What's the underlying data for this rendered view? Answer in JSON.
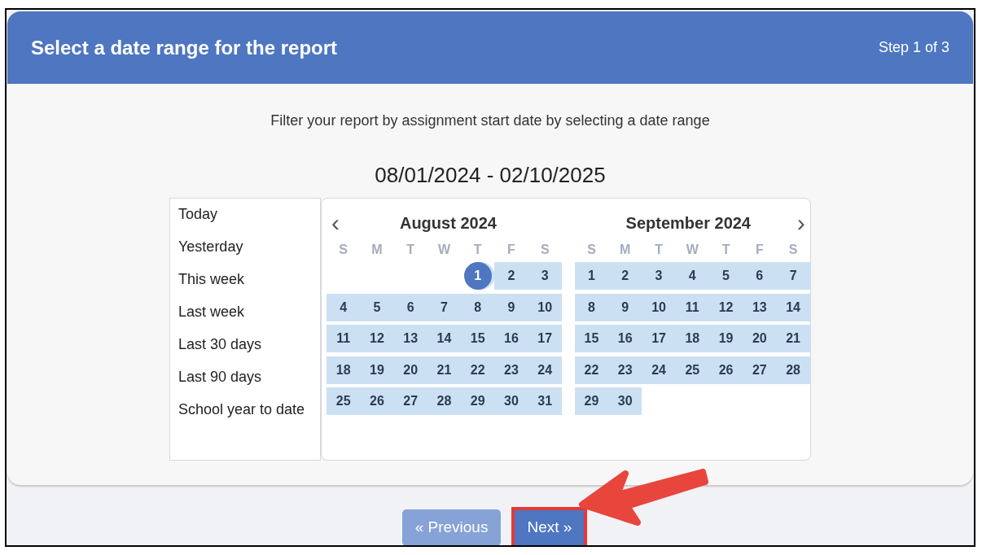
{
  "header": {
    "title": "Select a date range for the report",
    "step": "Step 1 of 3"
  },
  "instruction": "Filter your report by assignment start date by selecting a date range",
  "range": "08/01/2024 - 02/10/2025",
  "presets": [
    {
      "label": "Today"
    },
    {
      "label": "Yesterday"
    },
    {
      "label": "This week"
    },
    {
      "label": "Last week"
    },
    {
      "label": "Last 30 days"
    },
    {
      "label": "Last 90 days"
    },
    {
      "label": "School year to date"
    }
  ],
  "calendar": {
    "prev": "‹",
    "next": "›",
    "months": [
      {
        "title": "August 2024",
        "weekdays": [
          "S",
          "M",
          "T",
          "W",
          "T",
          "F",
          "S"
        ],
        "weeks": [
          [
            {
              "day": "1",
              "selected": true,
              "in_range": true
            },
            {
              "day": "2",
              "selected": false,
              "in_range": true
            },
            {
              "day": "3",
              "selected": false,
              "in_range": true
            }
          ],
          [
            {
              "day": "4",
              "selected": false,
              "in_range": true
            },
            {
              "day": "5",
              "selected": false,
              "in_range": true
            },
            {
              "day": "6",
              "selected": false,
              "in_range": true
            },
            {
              "day": "7",
              "selected": false,
              "in_range": true
            },
            {
              "day": "8",
              "selected": false,
              "in_range": true
            },
            {
              "day": "9",
              "selected": false,
              "in_range": true
            },
            {
              "day": "10",
              "selected": false,
              "in_range": true
            }
          ],
          [
            {
              "day": "11",
              "selected": false,
              "in_range": true
            },
            {
              "day": "12",
              "selected": false,
              "in_range": true
            },
            {
              "day": "13",
              "selected": false,
              "in_range": true
            },
            {
              "day": "14",
              "selected": false,
              "in_range": true
            },
            {
              "day": "15",
              "selected": false,
              "in_range": true
            },
            {
              "day": "16",
              "selected": false,
              "in_range": true
            },
            {
              "day": "17",
              "selected": false,
              "in_range": true
            }
          ],
          [
            {
              "day": "18",
              "selected": false,
              "in_range": true
            },
            {
              "day": "19",
              "selected": false,
              "in_range": true
            },
            {
              "day": "20",
              "selected": false,
              "in_range": true
            },
            {
              "day": "21",
              "selected": false,
              "in_range": true
            },
            {
              "day": "22",
              "selected": false,
              "in_range": true
            },
            {
              "day": "23",
              "selected": false,
              "in_range": true
            },
            {
              "day": "24",
              "selected": false,
              "in_range": true
            }
          ],
          [
            {
              "day": "25",
              "selected": false,
              "in_range": true
            },
            {
              "day": "26",
              "selected": false,
              "in_range": true
            },
            {
              "day": "27",
              "selected": false,
              "in_range": true
            },
            {
              "day": "28",
              "selected": false,
              "in_range": true
            },
            {
              "day": "29",
              "selected": false,
              "in_range": true
            },
            {
              "day": "30",
              "selected": false,
              "in_range": true
            },
            {
              "day": "31",
              "selected": false,
              "in_range": true
            }
          ]
        ]
      },
      {
        "title": "September 2024",
        "weekdays": [
          "S",
          "M",
          "T",
          "W",
          "T",
          "F",
          "S"
        ],
        "weeks": [
          [
            {
              "day": "1",
              "selected": false,
              "in_range": true
            },
            {
              "day": "2",
              "selected": false,
              "in_range": true
            },
            {
              "day": "3",
              "selected": false,
              "in_range": true
            },
            {
              "day": "4",
              "selected": false,
              "in_range": true
            },
            {
              "day": "5",
              "selected": false,
              "in_range": true
            },
            {
              "day": "6",
              "selected": false,
              "in_range": true
            },
            {
              "day": "7",
              "selected": false,
              "in_range": true
            }
          ],
          [
            {
              "day": "8",
              "selected": false,
              "in_range": true
            },
            {
              "day": "9",
              "selected": false,
              "in_range": true
            },
            {
              "day": "10",
              "selected": false,
              "in_range": true
            },
            {
              "day": "11",
              "selected": false,
              "in_range": true
            },
            {
              "day": "12",
              "selected": false,
              "in_range": true
            },
            {
              "day": "13",
              "selected": false,
              "in_range": true
            },
            {
              "day": "14",
              "selected": false,
              "in_range": true
            }
          ],
          [
            {
              "day": "15",
              "selected": false,
              "in_range": true
            },
            {
              "day": "16",
              "selected": false,
              "in_range": true
            },
            {
              "day": "17",
              "selected": false,
              "in_range": true
            },
            {
              "day": "18",
              "selected": false,
              "in_range": true
            },
            {
              "day": "19",
              "selected": false,
              "in_range": true
            },
            {
              "day": "20",
              "selected": false,
              "in_range": true
            },
            {
              "day": "21",
              "selected": false,
              "in_range": true
            }
          ],
          [
            {
              "day": "22",
              "selected": false,
              "in_range": true
            },
            {
              "day": "23",
              "selected": false,
              "in_range": true
            },
            {
              "day": "24",
              "selected": false,
              "in_range": true
            },
            {
              "day": "25",
              "selected": false,
              "in_range": true
            },
            {
              "day": "26",
              "selected": false,
              "in_range": true
            },
            {
              "day": "27",
              "selected": false,
              "in_range": true
            },
            {
              "day": "28",
              "selected": false,
              "in_range": true
            }
          ],
          [
            {
              "day": "29",
              "selected": false,
              "in_range": true
            },
            {
              "day": "30",
              "selected": false,
              "in_range": true
            }
          ]
        ]
      }
    ]
  },
  "buttons": [
    {
      "label": "« Previous",
      "disabled": true,
      "highlighted": false
    },
    {
      "label": "Next »",
      "disabled": false,
      "highlighted": true
    }
  ]
}
